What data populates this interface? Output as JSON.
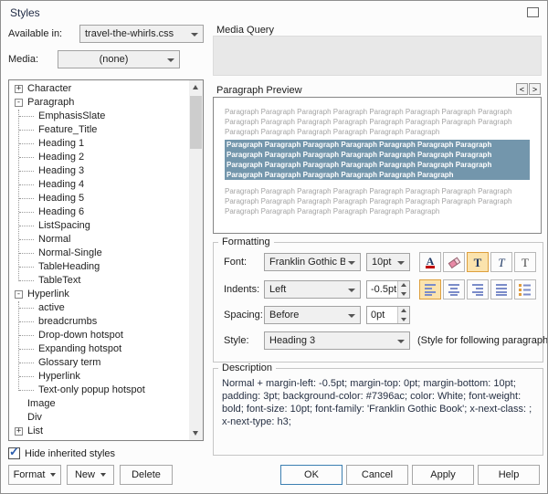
{
  "window": {
    "title": "Styles"
  },
  "selectors": {
    "available_in_label": "Available in:",
    "available_in_value": "travel-the-whirls.css",
    "media_label": "Media:",
    "media_value": "(none)"
  },
  "tree": {
    "items": [
      {
        "label": "Character",
        "glyph": "+"
      },
      {
        "label": "Paragraph",
        "glyph": "-"
      },
      {
        "label": "EmphasisSlate",
        "glyph": ""
      },
      {
        "label": "Feature_Title",
        "glyph": ""
      },
      {
        "label": "Heading 1",
        "glyph": ""
      },
      {
        "label": "Heading 2",
        "glyph": ""
      },
      {
        "label": "Heading 3",
        "glyph": ""
      },
      {
        "label": "Heading 4",
        "glyph": ""
      },
      {
        "label": "Heading 5",
        "glyph": ""
      },
      {
        "label": "Heading 6",
        "glyph": ""
      },
      {
        "label": "ListSpacing",
        "glyph": ""
      },
      {
        "label": "Normal",
        "glyph": ""
      },
      {
        "label": "Normal-Single",
        "glyph": ""
      },
      {
        "label": "TableHeading",
        "glyph": ""
      },
      {
        "label": "TableText",
        "glyph": ""
      },
      {
        "label": "Hyperlink",
        "glyph": "-"
      },
      {
        "label": "active",
        "glyph": ""
      },
      {
        "label": "breadcrumbs",
        "glyph": ""
      },
      {
        "label": "Drop-down hotspot",
        "glyph": ""
      },
      {
        "label": "Expanding hotspot",
        "glyph": ""
      },
      {
        "label": "Glossary term",
        "glyph": ""
      },
      {
        "label": "Hyperlink",
        "glyph": ""
      },
      {
        "label": "Text-only popup hotspot",
        "glyph": ""
      },
      {
        "label": "Image",
        "glyph": ""
      },
      {
        "label": "Div",
        "glyph": ""
      },
      {
        "label": "List",
        "glyph": "+"
      }
    ]
  },
  "hide_inherited": {
    "label": "Hide inherited styles",
    "check_icon": "✓"
  },
  "media_query": {
    "title": "Media Query"
  },
  "preview": {
    "title": "Paragraph Preview",
    "prev_icon": "<",
    "next_icon": ">",
    "before_text": "Paragraph Paragraph Paragraph Paragraph Paragraph Paragraph Paragraph Paragraph Paragraph Paragraph Paragraph Paragraph Paragraph Paragraph Paragraph Paragraph Paragraph Paragraph Paragraph Paragraph Paragraph Paragraph",
    "selected_text": "Paragraph Paragraph Paragraph Paragraph Paragraph Paragraph Paragraph Paragraph Paragraph Paragraph Paragraph Paragraph Paragraph Paragraph Paragraph Paragraph Paragraph Paragraph Paragraph Paragraph Paragraph Paragraph Paragraph Paragraph Paragraph Paragraph Paragraph",
    "after_text": "Paragraph Paragraph Paragraph Paragraph Paragraph Paragraph Paragraph Paragraph Paragraph Paragraph Paragraph Paragraph Paragraph Paragraph Paragraph Paragraph Paragraph Paragraph Paragraph Paragraph Paragraph Paragraph"
  },
  "formatting": {
    "title": "Formatting",
    "font_label": "Font:",
    "font_value": "Franklin Gothic B",
    "size_value": "10pt",
    "indents_label": "Indents:",
    "indents_value": "Left",
    "indent_amount": "-0.5pt",
    "spacing_label": "Spacing:",
    "spacing_value": "Before",
    "spacing_amount": "0pt",
    "style_label": "Style:",
    "style_value": "Heading 3",
    "style_note": "(Style for following paragraph)",
    "icons": {
      "font_color": "A",
      "bold": "T",
      "italic": "T",
      "underline": "T"
    }
  },
  "description": {
    "title": "Description",
    "text": "Normal + margin-left: -0.5pt; margin-top: 0pt; margin-bottom: 10pt; padding: 3pt; background-color: #7396ac; color: White; font-weight: bold; font-size: 10pt; font-family: 'Franklin Gothic Book'; x-next-class: ; x-next-type: h3;"
  },
  "footer": {
    "format_label": "Format",
    "new_label": "New",
    "delete_label": "Delete",
    "ok_label": "OK",
    "cancel_label": "Cancel",
    "apply_label": "Apply",
    "help_label": "Help"
  },
  "colors": {
    "selection_bg": "#7396ac",
    "active_toggle_bg": "#fbe3ad",
    "active_toggle_border": "#dd9f3d"
  }
}
